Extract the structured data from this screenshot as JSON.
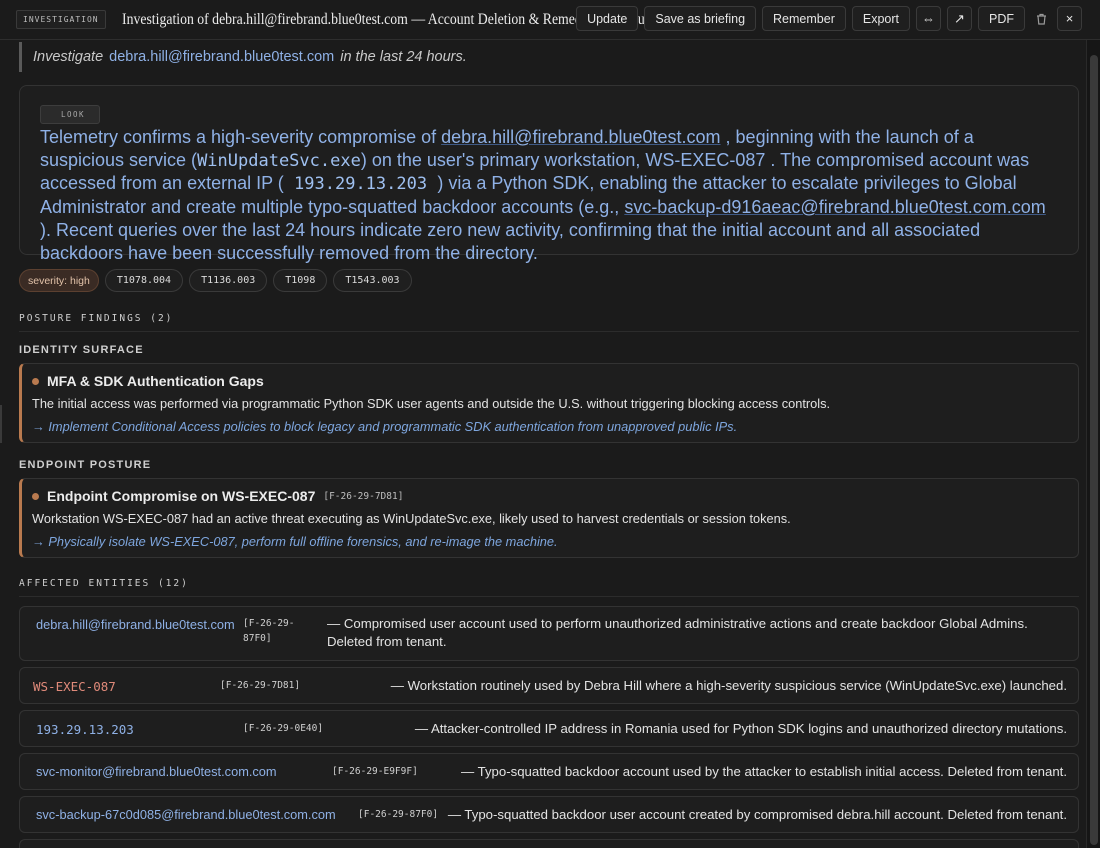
{
  "window": {
    "kind_badge": "INVESTIGATION",
    "title": "Investigation of debra.hill@firebrand.blue0test.com — Account Deletion & Remediation Status"
  },
  "toolbar": {
    "update": "Update",
    "save_briefing": "Save as briefing",
    "remember": "Remember",
    "export": "Export",
    "expand_icon": "⇔",
    "popout_icon": "↗",
    "pdf": "PDF",
    "trash_icon": "🗑",
    "close_icon": "×"
  },
  "prompt": {
    "before": "Investigate",
    "email": "debra.hill@firebrand.blue0test.com",
    "after": "in the last 24 hours."
  },
  "summary": {
    "badge": "LOOK",
    "p1": "Telemetry confirms a high-severity compromise of ",
    "email": "debra.hill@firebrand.blue0test.com",
    "p2": " , beginning with the launch of a suspicious service (",
    "service": "WinUpdateSvc.exe",
    "p3": ") on the user's primary workstation,  WS-EXEC-087 . The compromised account was accessed from an external IP (",
    "ip": " 193.29.13.203 ",
    "p4": ") via a Python SDK, enabling the attacker to escalate privileges to Global Administrator and create multiple typo-squatted backdoor accounts (e.g., ",
    "example": "svc-backup-d916aeac@firebrand.blue0test.com.com",
    "p5": " ). Recent queries over the last 24 hours indicate zero new activity, confirming that the initial account and all associated backdoors have been successfully removed from the directory."
  },
  "tags": [
    "severity: high",
    "T1078.004",
    "T1136.003",
    "T1098",
    "T1543.003"
  ],
  "posture": {
    "title": "POSTURE FINDINGS (2)",
    "groups": [
      {
        "title": "IDENTITY SURFACE",
        "finding": {
          "title": "MFA & SDK Authentication Gaps",
          "ref": "",
          "body": "The initial access was performed via programmatic Python SDK user agents and outside the U.S. without triggering blocking access controls.",
          "recommendation": "→ Implement Conditional Access policies to block legacy and programmatic SDK authentication from unapproved public IPs."
        }
      },
      {
        "title": "ENDPOINT POSTURE",
        "finding": {
          "title": "Endpoint Compromise on WS-EXEC-087",
          "ref": "[F-26-29-7D81]",
          "body": "Workstation WS-EXEC-087 had an active threat executing as WinUpdateSvc.exe, likely used to harvest credentials or session tokens.",
          "recommendation": "→ Physically isolate WS-EXEC-087, perform full offline forensics, and re-image the machine."
        }
      }
    ]
  },
  "entities": {
    "title": "AFFECTED ENTITIES (12)",
    "items": [
      {
        "name": "debra.hill@firebrand.blue0test.com",
        "ref": "[F-26-29-87F0]",
        "desc": "— Compromised user account used to perform unauthorized administrative actions and create backdoor Global Admins. Deleted from tenant."
      },
      {
        "name": "WS-EXEC-087",
        "ref": "[F-26-29-7D81]",
        "desc": "— Workstation routinely used by Debra Hill where a high-severity suspicious service (WinUpdateSvc.exe) launched."
      },
      {
        "name": "193.29.13.203",
        "ref": "[F-26-29-0E40]",
        "desc": "— Attacker-controlled IP address in Romania used for Python SDK logins and unauthorized directory mutations."
      },
      {
        "name": "svc-monitor@firebrand.blue0test.com.com",
        "ref": "[F-26-29-E9F9F]",
        "desc": "— Typo-squatted backdoor account used by the attacker to establish initial access. Deleted from tenant."
      },
      {
        "name": "svc-backup-67c0d085@firebrand.blue0test.com.com",
        "ref": "[F-26-29-87F0]",
        "desc": "— Typo-squatted backdoor user account created by compromised debra.hill account. Deleted from tenant."
      }
    ]
  }
}
